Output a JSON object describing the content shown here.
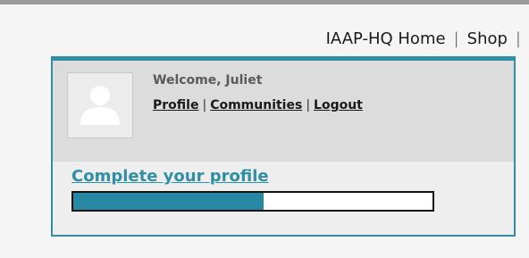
{
  "header": {
    "nav_items": [
      {
        "label": "IAAP-HQ Home"
      },
      {
        "label": "Shop"
      }
    ]
  },
  "widget": {
    "welcome_text": "Welcome, Juliet",
    "links": [
      {
        "label": "Profile"
      },
      {
        "label": "Communities"
      },
      {
        "label": "Logout"
      }
    ],
    "avatar_icon": "user-silhouette-icon",
    "complete_profile_label": "Complete your profile",
    "profile_completion_percent": 53
  },
  "colors": {
    "accent": "#2e8fa5",
    "progress_fill": "#2688a2",
    "panel_bg": "#dcdcdc"
  }
}
